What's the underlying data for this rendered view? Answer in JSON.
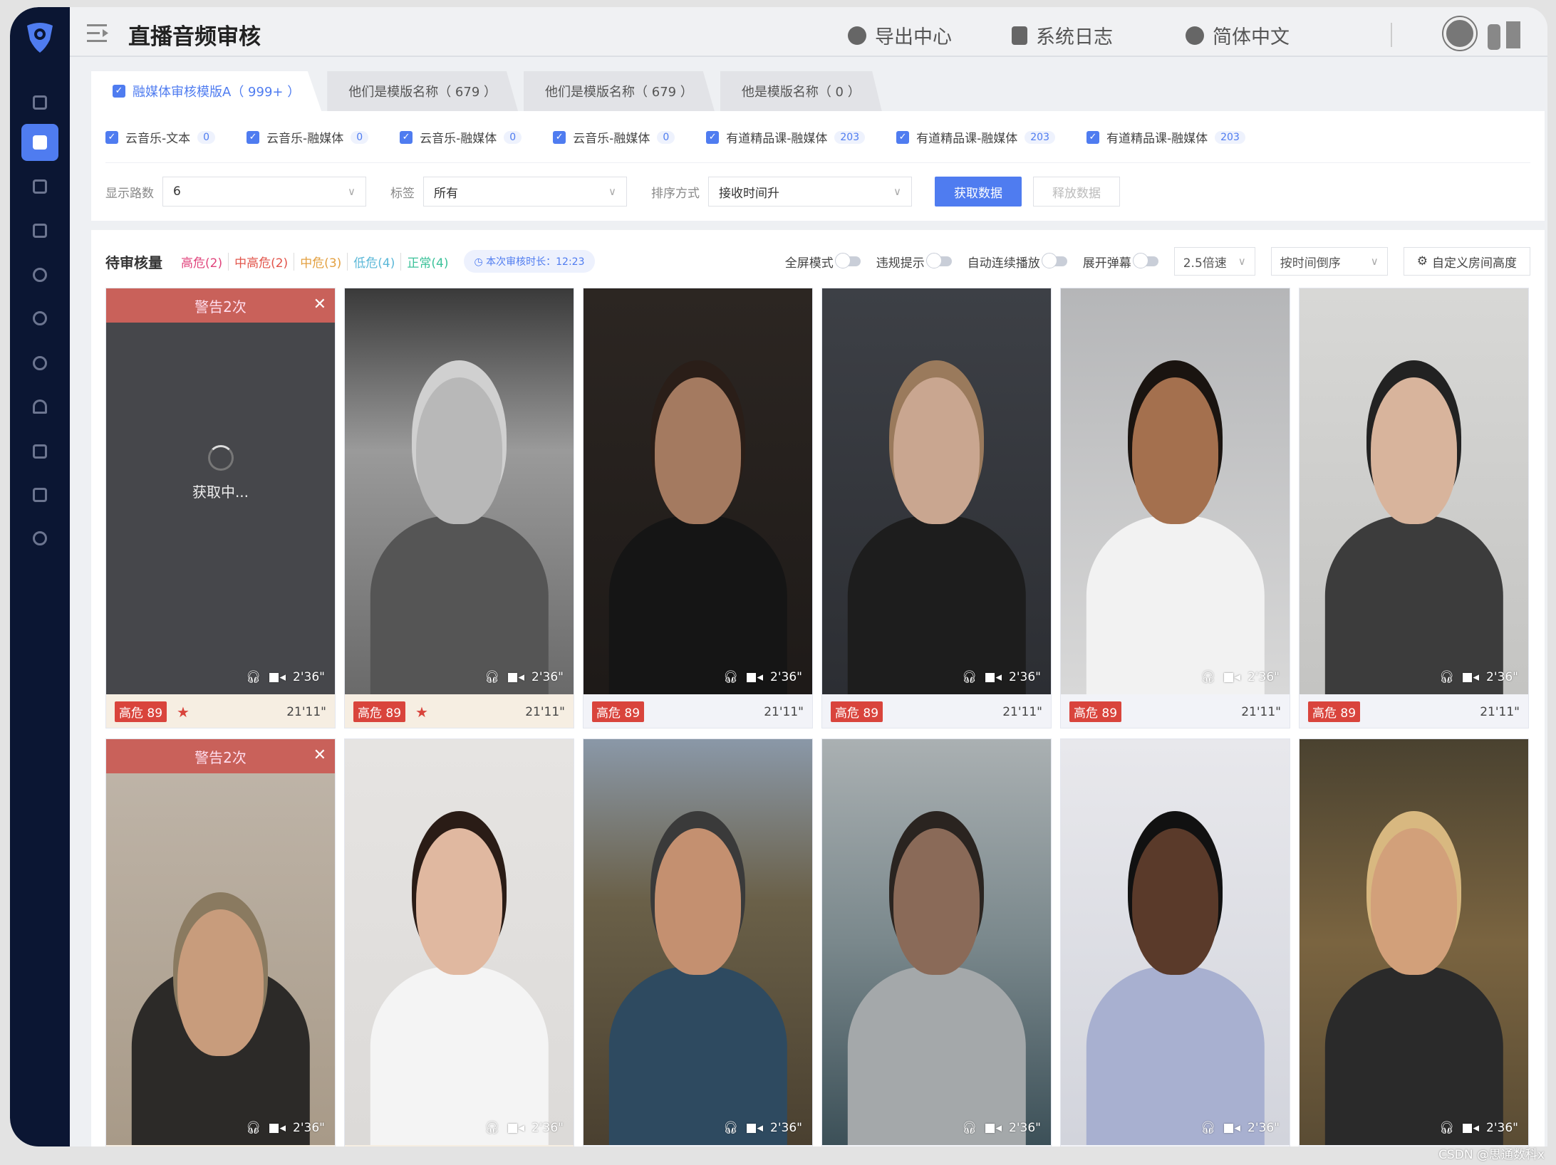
{
  "header": {
    "title": "直播音频审核",
    "nav": [
      {
        "icon": "cloud-download-icon",
        "label": "导出中心"
      },
      {
        "icon": "log-icon",
        "label": "系统日志"
      },
      {
        "icon": "globe-icon",
        "label": "简体中文"
      }
    ]
  },
  "tabs": [
    {
      "label": "融媒体审核模版A（ 999+ ）",
      "active": true,
      "checked": true
    },
    {
      "label": "他们是模版名称（ 679 ）"
    },
    {
      "label": "他们是模版名称（ 679 ）"
    },
    {
      "label": "他是模版名称（ 0 ）"
    }
  ],
  "channels": [
    {
      "label": "云音乐-文本",
      "count": "0"
    },
    {
      "label": "云音乐-融媒体",
      "count": "0"
    },
    {
      "label": "云音乐-融媒体",
      "count": "0"
    },
    {
      "label": "云音乐-融媒体",
      "count": "0"
    },
    {
      "label": "有道精品课-融媒体",
      "count": "203"
    },
    {
      "label": "有道精品课-融媒体",
      "count": "203"
    },
    {
      "label": "有道精品课-融媒体",
      "count": "203"
    }
  ],
  "filters": {
    "display_label": "显示路数",
    "display_value": "6",
    "tag_label": "标签",
    "tag_value": "所有",
    "sort_label": "排序方式",
    "sort_value": "接收时间升",
    "fetch": "获取数据",
    "release": "释放数据"
  },
  "review": {
    "title": "待审核量",
    "levels": [
      {
        "label": "高危(2)",
        "color": "#e0447c"
      },
      {
        "label": "中高危(2)",
        "color": "#e2554b"
      },
      {
        "label": "中危(3)",
        "color": "#e3a040"
      },
      {
        "label": "低危(4)",
        "color": "#5bb8d8"
      },
      {
        "label": "正常(4)",
        "color": "#3cc29a"
      }
    ],
    "timer": "本次审核时长：12:23",
    "toggles": [
      {
        "label": "全屏模式",
        "on": false
      },
      {
        "label": "违规提示",
        "on": false
      },
      {
        "label": "自动连续播放",
        "on": false
      },
      {
        "label": "展开弹幕",
        "on": false
      }
    ],
    "speed": "2.5倍速",
    "order": "按时间倒序",
    "custom": "自定义房间高度"
  },
  "card_common": {
    "warning": "警告2次",
    "loading": "获取中...",
    "risk": "高危 89",
    "duration": "2'36\"",
    "elapsed": "21'11\""
  },
  "cards": [
    {
      "warning": true,
      "loading": true,
      "starred": true,
      "footer": "#f6eee2",
      "bg": "#46474b"
    },
    {
      "starred": true,
      "footer": "#f6eee2",
      "bg": "linear-gradient(180deg,#3a3a3a,#9a9a9a 40%,#6a6a6a)",
      "skin": "#b8b8b8",
      "hair": "#d0d0d0",
      "cloth": "#555"
    },
    {
      "footer": "#f2f3f8",
      "bg": "linear-gradient(180deg,#2c2622,#1e1a18)",
      "skin": "#a47a60",
      "hair": "#2a1e18",
      "cloth": "#151515"
    },
    {
      "footer": "#f2f3f8",
      "bg": "linear-gradient(180deg,#3d4046,#2c2e33)",
      "skin": "#c9a690",
      "hair": "#9a7a5c",
      "cloth": "#1d1d1d"
    },
    {
      "footer": "#f2f3f8",
      "bg": "linear-gradient(180deg,#b5b6b8,#d8d8d8)",
      "skin": "#a4704e",
      "hair": "#1a1410",
      "cloth": "#f2f2f2"
    },
    {
      "footer": "#f2f3f8",
      "bg": "linear-gradient(180deg,#d8d8d6,#c4c4c2)",
      "skin": "#d8b49c",
      "hair": "#222",
      "cloth": "#3c3c3c"
    },
    {
      "warning": true,
      "footer": "#f6eee2",
      "bg": "linear-gradient(180deg,#c0b6aa,#a89a88)",
      "skin": "#c89c7c",
      "hair": "#8a7a60",
      "cloth": "#2c2a28"
    },
    {
      "footer": "#f6eee2",
      "bg": "linear-gradient(180deg,#e6e4e2,#dcdad8)",
      "skin": "#e0b8a0",
      "hair": "#2a1c16",
      "cloth": "#f4f4f4"
    },
    {
      "footer": "#f2f3f8",
      "bg": "linear-gradient(180deg,#8a98a8,#6a6048 40%,#4a4030)",
      "skin": "#c49070",
      "hair": "#3a3a3a",
      "cloth": "#2e4a60"
    },
    {
      "footer": "#f2f3f8",
      "bg": "linear-gradient(180deg,#aab0b2,#7a888c 50%,#3c5058)",
      "skin": "#8a6a58",
      "hair": "#2a2420",
      "cloth": "#a4a8aa"
    },
    {
      "footer": "#f2f3f8",
      "bg": "linear-gradient(180deg,#e8e8ec,#d2d4dc)",
      "skin": "#5a3a2a",
      "hair": "#111",
      "cloth": "#a8b0d0"
    },
    {
      "footer": "#f2f3f8",
      "bg": "linear-gradient(180deg,#4a4230,#7a6440 50%,#5a4c34)",
      "skin": "#d2a07a",
      "hair": "#d8b880",
      "cloth": "#2a2a2a"
    }
  ],
  "watermark": "CSDN @思通数科x"
}
